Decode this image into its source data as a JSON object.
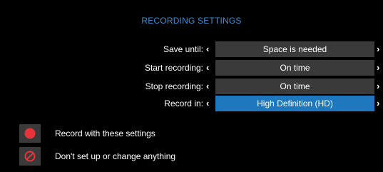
{
  "header": {
    "title": "RECORDING SETTINGS"
  },
  "settings": [
    {
      "label": "Save until:",
      "value": "Space is needed",
      "selected": false
    },
    {
      "label": "Start recording:",
      "value": "On time",
      "selected": false
    },
    {
      "label": "Stop recording:",
      "value": "On time",
      "selected": false
    },
    {
      "label": "Record in:",
      "value": "High Definition (HD)",
      "selected": true
    }
  ],
  "arrows": {
    "left": "‹",
    "right": "›"
  },
  "actions": [
    {
      "label": "Record with these settings",
      "icon": "record-dot-icon"
    },
    {
      "label": "Don't set up or change anything",
      "icon": "cancel-circle-icon"
    }
  ],
  "colors": {
    "background": "#000000",
    "title": "#3a8fd6",
    "value_box": "#3a3a3a",
    "value_box_selected": "#1f78be",
    "record_red": "#e8333a"
  }
}
